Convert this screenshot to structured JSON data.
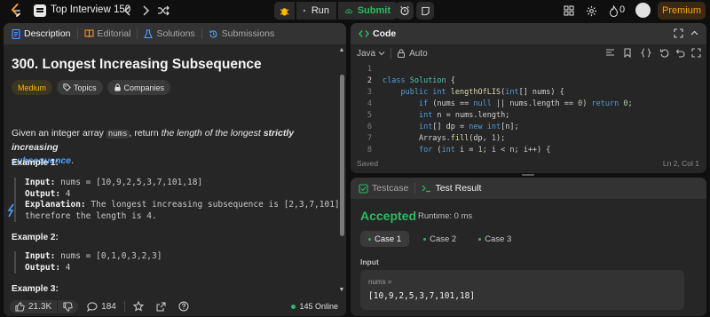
{
  "topbar": {
    "problem_list_title": "Top Interview 150",
    "run_label": "Run",
    "submit_label": "Submit",
    "fire_count": "0",
    "premium_label": "Premium"
  },
  "left_panel": {
    "tabs": [
      {
        "label": "Description",
        "icon": "description-icon",
        "active": true
      },
      {
        "label": "Editorial",
        "icon": "book-icon",
        "active": false
      },
      {
        "label": "Solutions",
        "icon": "flask-icon",
        "active": false
      },
      {
        "label": "Submissions",
        "icon": "history-icon",
        "active": false
      }
    ],
    "title": "300. Longest Increasing Subsequence",
    "difficulty": "Medium",
    "topics_label": "Topics",
    "companies_label": "Companies",
    "description": {
      "prefix": "Given an integer array ",
      "code": "nums",
      "middle": ", return ",
      "italic": "the length of the longest ",
      "bold_italic_1": "strictly increasing",
      "bold_italic_2": "subsequence",
      "suffix": "."
    },
    "examples": [
      {
        "heading": "Example 1:",
        "input_label": "Input:",
        "input": "nums = [10,9,2,5,3,7,101,18]",
        "output_label": "Output:",
        "output": "4",
        "explanation_label": "Explanation:",
        "explanation_line1": "The longest increasing subsequence is [2,3,7,101],",
        "explanation_line2": "therefore the length is 4."
      },
      {
        "heading": "Example 2:",
        "input_label": "Input:",
        "input": "nums = [0,1,0,3,2,3]",
        "output_label": "Output:",
        "output": "4"
      },
      {
        "heading": "Example 3:"
      }
    ],
    "footer": {
      "likes": "21.3K",
      "comments": "184",
      "online": "145 Online"
    }
  },
  "code_panel": {
    "title": "Code",
    "language": "Java",
    "mode": "Auto",
    "line_numbers": [
      "1",
      "2",
      "3",
      "4",
      "5",
      "6",
      "7",
      "8"
    ],
    "status": "Saved",
    "cursor": "Ln 2, Col 1"
  },
  "test_panel": {
    "tabs": [
      {
        "label": "Testcase",
        "active": false
      },
      {
        "label": "Test Result",
        "active": true
      }
    ],
    "result": "Accepted",
    "runtime": "Runtime: 0 ms",
    "cases": [
      "Case 1",
      "Case 2",
      "Case 3"
    ],
    "input_label": "Input",
    "var_name": "nums =",
    "var_value": "[10,9,2,5,3,7,101,18]"
  },
  "colors": {
    "accent_green": "#2cbb5d",
    "medium_yellow": "#ffb800",
    "link_blue": "#4ea1ff",
    "premium_orange": "#ffa116"
  }
}
